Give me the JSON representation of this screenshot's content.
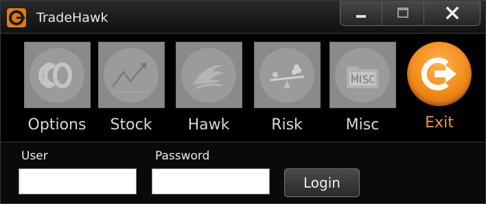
{
  "window": {
    "title": "TradeHawk",
    "logo_icon": "tradehawk-logo-icon",
    "controls": [
      {
        "name": "minimize-button",
        "icon": "minimize-icon"
      },
      {
        "name": "maximize-button",
        "icon": "maximize-icon"
      },
      {
        "name": "close-button",
        "icon": "close-icon"
      }
    ]
  },
  "toolbar": {
    "items": [
      {
        "label": "Options",
        "icon": "options-icon",
        "state": "disabled"
      },
      {
        "label": "Stock",
        "icon": "stock-chart-icon",
        "state": "disabled"
      },
      {
        "label": "Hawk",
        "icon": "hawk-icon",
        "state": "disabled"
      },
      {
        "label": "Risk",
        "icon": "seesaw-icon",
        "state": "disabled"
      },
      {
        "label": "Misc",
        "icon": "misc-folder-icon",
        "state": "disabled"
      },
      {
        "label": "Exit",
        "icon": "exit-icon",
        "state": "active"
      }
    ]
  },
  "login": {
    "user_label": "User",
    "user_value": "",
    "password_label": "Password",
    "password_value": "",
    "login_button": "Login"
  },
  "colors": {
    "exit_accent": "#f29a2e",
    "disabled_tile": "#8a8a8a",
    "background": "#000000"
  }
}
